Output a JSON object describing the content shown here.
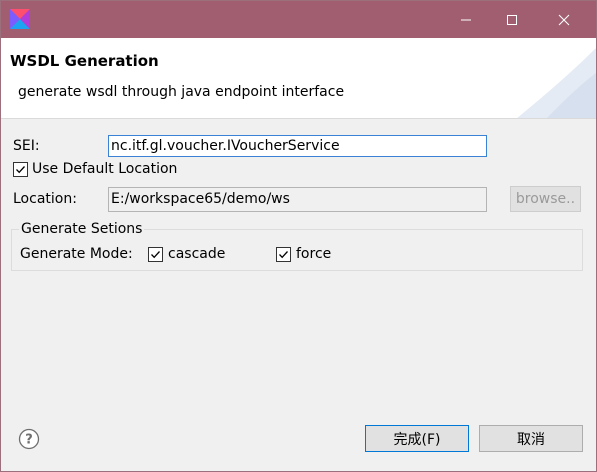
{
  "titlebar": {
    "icons": [
      "app-icon",
      "minimize-icon",
      "maximize-icon",
      "close-icon"
    ]
  },
  "banner": {
    "title": "WSDL Generation",
    "description": "generate wsdl through java endpoint interface"
  },
  "form": {
    "sei_label": "SEI:",
    "sei_value": "nc.itf.gl.voucher.IVoucherService",
    "use_default_label": "Use Default Location",
    "use_default_checked": true,
    "location_label": "Location:",
    "location_value": "E:/workspace65/demo/ws",
    "browse_label": "browse.."
  },
  "group": {
    "title": "Generate Setions",
    "mode_label": "Generate Mode:",
    "cascade_label": "cascade",
    "cascade_checked": true,
    "force_label": "force",
    "force_checked": true
  },
  "footer": {
    "help_icon": "help-icon",
    "finish_label": "完成(F)",
    "cancel_label": "取消"
  },
  "colors": {
    "titlebar": "#a15e71",
    "primary_border": "#0078d7",
    "focus_border": "#3a82d6"
  }
}
